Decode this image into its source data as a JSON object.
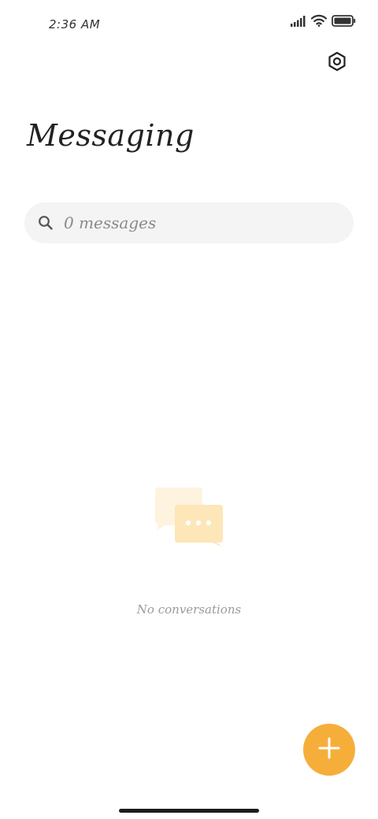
{
  "status_bar": {
    "time": "2:36 AM",
    "icons": [
      "signal-icon",
      "wifi-icon",
      "battery-icon"
    ]
  },
  "header": {
    "title": "Messaging",
    "settings_icon": "settings-hexagon-icon"
  },
  "search": {
    "placeholder": "0 messages",
    "icon": "search-icon"
  },
  "empty_state": {
    "icon": "chat-bubbles-icon",
    "text": "No conversations"
  },
  "fab": {
    "icon": "plus-icon",
    "color": "#f6ae3b"
  },
  "colors": {
    "accent": "#f6ae3b",
    "search_bg": "#f4f4f4",
    "empty_icon_light": "#fdf1d9",
    "empty_icon_dark": "#fde5b3"
  }
}
